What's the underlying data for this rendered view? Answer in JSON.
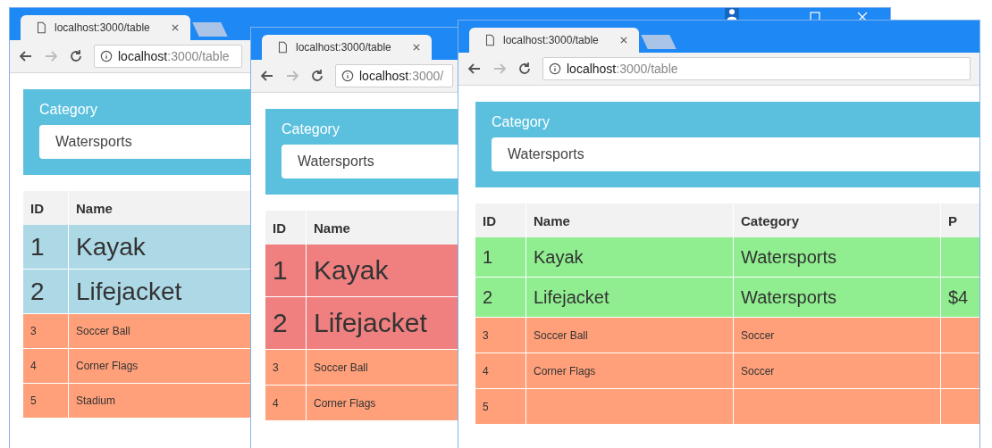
{
  "windows": [
    {
      "tab_title": "localhost:3000/table",
      "url_host": "localhost",
      "url_path": ":3000/table",
      "filter": {
        "label": "Category",
        "value": "Watersports"
      },
      "table": {
        "columns": [
          "ID",
          "Name"
        ],
        "rows": [
          {
            "highlighted": true,
            "color": "#add8e6",
            "cells": [
              "1",
              "Kayak"
            ]
          },
          {
            "highlighted": true,
            "color": "#add8e6",
            "cells": [
              "2",
              "Lifejacket"
            ]
          },
          {
            "highlighted": false,
            "color": "#ffa07a",
            "cells": [
              "3",
              "Soccer Ball"
            ]
          },
          {
            "highlighted": false,
            "color": "#ffa07a",
            "cells": [
              "4",
              "Corner Flags"
            ]
          },
          {
            "highlighted": false,
            "color": "#ffa07a",
            "cells": [
              "5",
              "Stadium"
            ]
          }
        ]
      }
    },
    {
      "tab_title": "localhost:3000/table",
      "url_host": "localhost",
      "url_path": ":3000/",
      "filter": {
        "label": "Category",
        "value": "Watersports"
      },
      "table": {
        "columns": [
          "ID",
          "Name"
        ],
        "rows": [
          {
            "highlighted": true,
            "color": "#f08080",
            "cells": [
              "1",
              "Kayak"
            ]
          },
          {
            "highlighted": true,
            "color": "#f08080",
            "cells": [
              "2",
              "Lifejacket"
            ]
          },
          {
            "highlighted": false,
            "color": "#ffa07a",
            "cells": [
              "3",
              "Soccer Ball"
            ]
          },
          {
            "highlighted": false,
            "color": "#ffa07a",
            "cells": [
              "4",
              "Corner Flags"
            ]
          }
        ]
      }
    },
    {
      "tab_title": "localhost:3000/table",
      "url_host": "localhost",
      "url_path": ":3000/table",
      "filter": {
        "label": "Category",
        "value": "Watersports"
      },
      "table": {
        "columns": [
          "ID",
          "Name",
          "Category",
          "P"
        ],
        "rows": [
          {
            "highlighted": true,
            "color": "#90ee90",
            "cells": [
              "1",
              "Kayak",
              "Watersports",
              ""
            ]
          },
          {
            "highlighted": true,
            "color": "#90ee90",
            "cells": [
              "2",
              "Lifejacket",
              "Watersports",
              "$4"
            ]
          },
          {
            "highlighted": false,
            "color": "#ffa07a",
            "cells": [
              "3",
              "Soccer Ball",
              "Soccer",
              ""
            ]
          },
          {
            "highlighted": false,
            "color": "#ffa07a",
            "cells": [
              "4",
              "Corner Flags",
              "Soccer",
              ""
            ]
          },
          {
            "highlighted": false,
            "color": "#ffa07a",
            "cells": [
              "5",
              "",
              "",
              ""
            ]
          }
        ]
      }
    }
  ]
}
